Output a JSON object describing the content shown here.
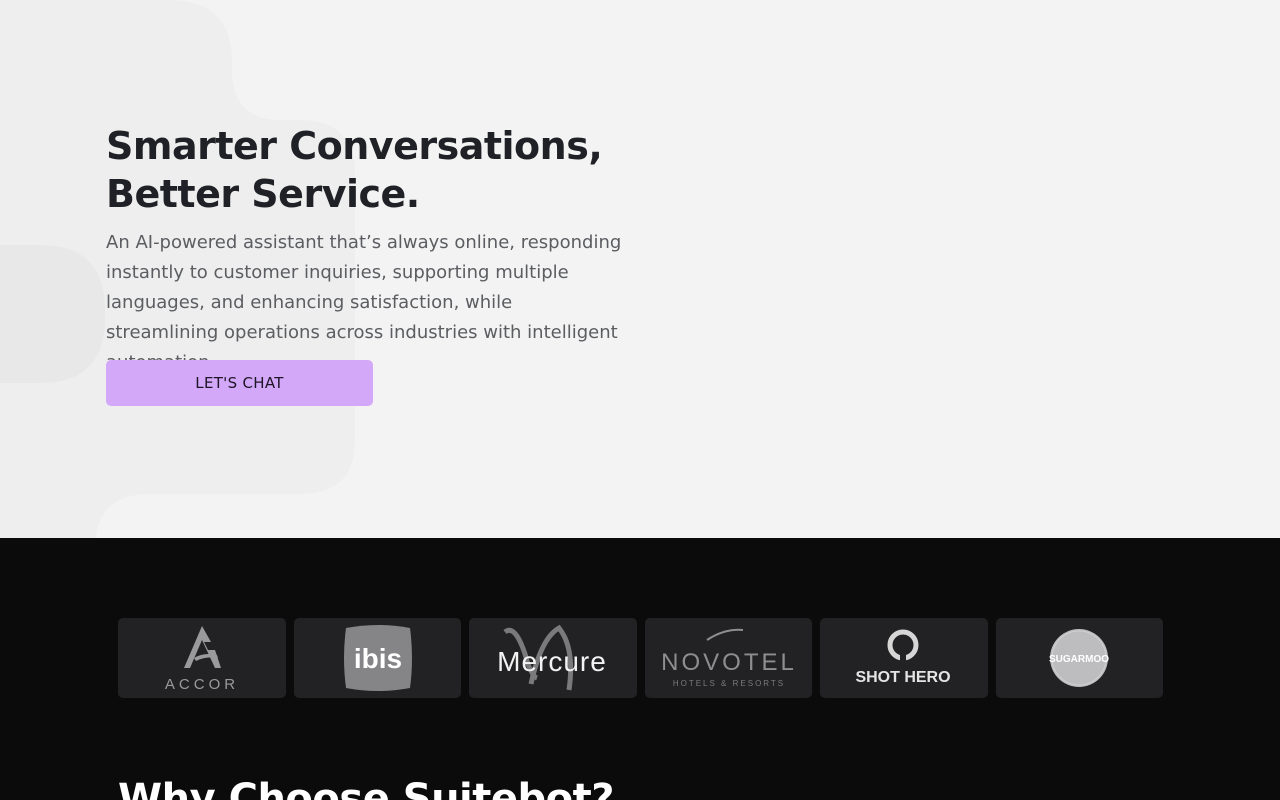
{
  "hero": {
    "title_line1": "Smarter Conversations,",
    "title_line2": "Better Service.",
    "subtitle": "An AI-powered assistant that’s always online, responding instantly to customer inquiries, supporting multiple languages, and enhancing satisfaction, while streamlining operations across industries with intelligent automation.",
    "cta_label": "LET'S CHAT"
  },
  "logos": [
    {
      "name": "accor",
      "text": "ACCOR"
    },
    {
      "name": "ibis",
      "text": "ibis"
    },
    {
      "name": "mercure",
      "text": "Mercure"
    },
    {
      "name": "novotel",
      "text": "NOVOTEL",
      "subtext": "HOTELS & RESORTS"
    },
    {
      "name": "shothero",
      "text": "SHOT HERO"
    },
    {
      "name": "sugarmoo",
      "text": "SUGARMOO"
    }
  ],
  "section": {
    "title": "Why Choose Suitebot?"
  },
  "colors": {
    "hero_bg": "#f3f3f3",
    "cta_bg": "#d3a8f8",
    "dark_bg": "#0b0b0c",
    "logo_card_bg": "#222224"
  }
}
